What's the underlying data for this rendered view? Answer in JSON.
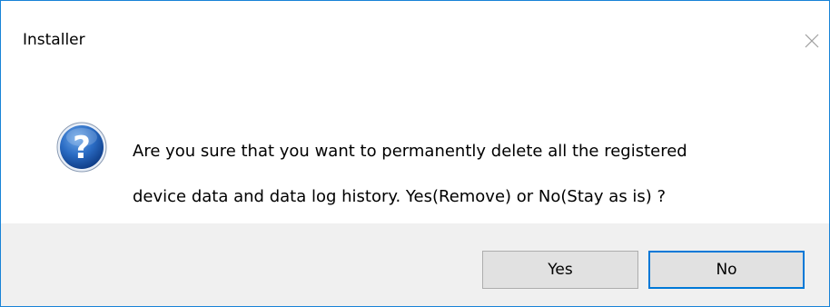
{
  "window": {
    "title": "Installer",
    "close_icon": "close-icon"
  },
  "message": {
    "icon": "question-icon",
    "text_line1": "Are you sure that you want to permanently delete all the registered",
    "text_line2": "device data and data log history. Yes(Remove) or No(Stay as is) ?"
  },
  "buttons": {
    "yes_label": "Yes",
    "no_label": "No"
  },
  "colors": {
    "border": "#1883d7",
    "footer_bg": "#f0f0f0",
    "button_bg": "#e1e1e1",
    "default_button_border": "#0078d7",
    "icon_blue": "#1c5fb4"
  }
}
